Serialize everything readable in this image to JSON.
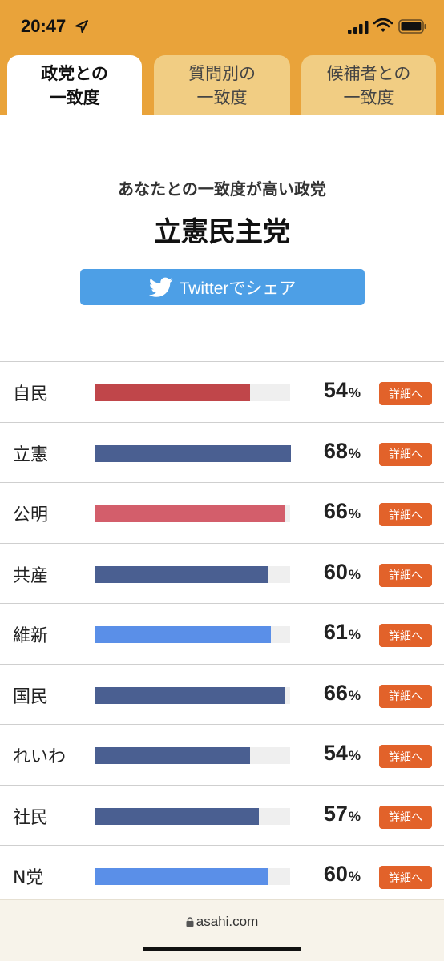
{
  "status_bar": {
    "time": "20:47"
  },
  "tabs": [
    {
      "label": "政党との\n一致度",
      "active": true
    },
    {
      "label": "質問別の\n一致度",
      "active": false
    },
    {
      "label": "候補者との\n一致度",
      "active": false
    }
  ],
  "result": {
    "subtitle": "あなたとの一致度が高い政党",
    "top_party": "立憲民主党",
    "share_label": "Twitterでシェア"
  },
  "parties": [
    {
      "name": "自民",
      "value": "54",
      "percent": 54,
      "color": "#c0464a",
      "detail": "詳細へ"
    },
    {
      "name": "立憲",
      "value": "68",
      "percent": 68,
      "color": "#4a5f91",
      "detail": "詳細へ"
    },
    {
      "name": "公明",
      "value": "66",
      "percent": 66,
      "color": "#d35e6b",
      "detail": "詳細へ"
    },
    {
      "name": "共産",
      "value": "60",
      "percent": 60,
      "color": "#4a5f91",
      "detail": "詳細へ"
    },
    {
      "name": "維新",
      "value": "61",
      "percent": 61,
      "color": "#5a8fe8",
      "detail": "詳細へ"
    },
    {
      "name": "国民",
      "value": "66",
      "percent": 66,
      "color": "#4a5f91",
      "detail": "詳細へ"
    },
    {
      "name": "れいわ",
      "value": "54",
      "percent": 54,
      "color": "#4a5f91",
      "detail": "詳細へ"
    },
    {
      "name": "社民",
      "value": "57",
      "percent": 57,
      "color": "#4a5f91",
      "detail": "詳細へ"
    },
    {
      "name": "N党",
      "value": "60",
      "percent": 60,
      "color": "#5a8fe8",
      "detail": "詳細へ"
    }
  ],
  "percent_unit": "%",
  "browser": {
    "domain": "asahi.com"
  },
  "colors": {
    "header_bg": "#e9a33a",
    "tab_inactive": "#f1cd83",
    "share_button": "#4d9fe6",
    "detail_button": "#e2622a"
  }
}
